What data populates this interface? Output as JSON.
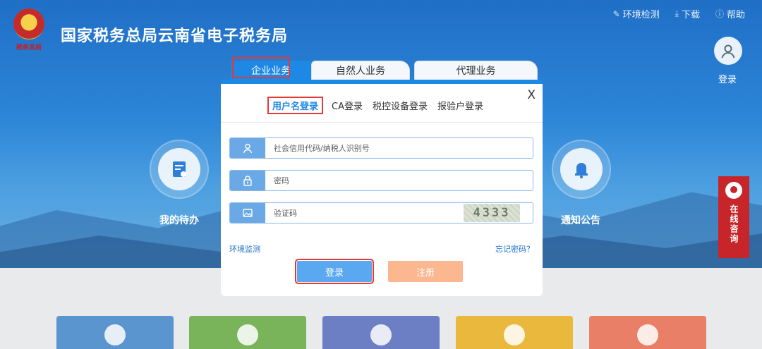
{
  "site": {
    "title": "国家税务总局云南省电子税务局",
    "emblem_text": "税务总局"
  },
  "topnav": [
    {
      "icon": "wrench-icon",
      "label": "环境检测"
    },
    {
      "icon": "download-icon",
      "label": "下载"
    },
    {
      "icon": "help-icon",
      "label": "帮助"
    }
  ],
  "user": {
    "login_label": "登录"
  },
  "hero_shortcuts": {
    "todo": "我的待办",
    "notice": "通知公告"
  },
  "consult": {
    "label": "在线咨询"
  },
  "modal": {
    "tabs": [
      "企业业务",
      "自然人业务",
      "代理业务"
    ],
    "close": "X",
    "subtabs": [
      "用户名登录",
      "CA登录",
      "税控设备登录",
      "报验户登录"
    ],
    "fields": {
      "account_placeholder": "社会信用代码/纳税人识别号",
      "password_placeholder": "密码",
      "captcha_placeholder": "验证码",
      "captcha_code": "4333"
    },
    "links": {
      "env_check": "环境监测",
      "forgot": "忘记密码？"
    },
    "buttons": {
      "login": "登录",
      "register": "注册"
    }
  },
  "colors": {
    "primary": "#1e88e5",
    "highlight": "#e53935",
    "register": "#fbb78f",
    "consult": "#c8252a"
  },
  "cards_colors": [
    "#5b95cf",
    "#79b35a",
    "#6c7fc4",
    "#e9b83d",
    "#e87f66"
  ]
}
